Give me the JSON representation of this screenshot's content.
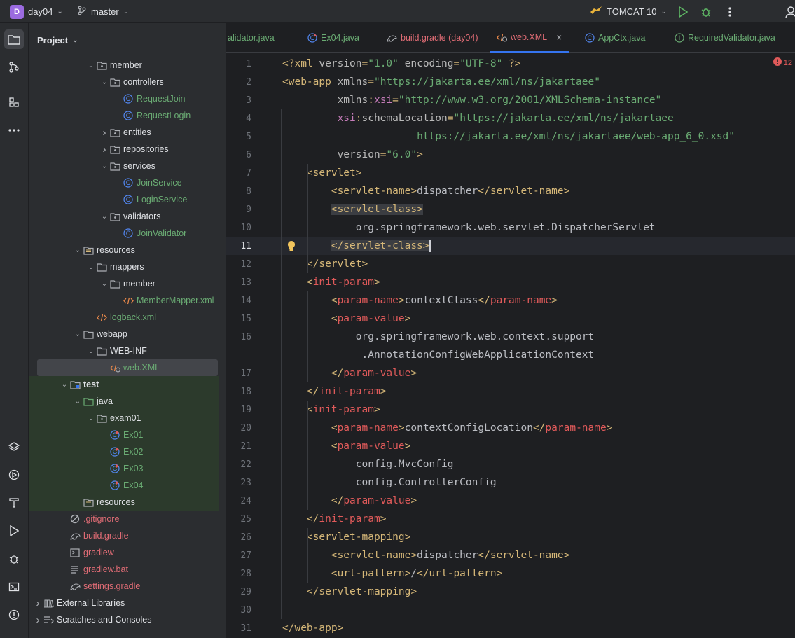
{
  "topbar": {
    "project_badge": "D",
    "project_name": "day04",
    "branch": "master",
    "run_config": "TOMCAT 10"
  },
  "panel": {
    "title": "Project"
  },
  "tree": [
    {
      "label": "member",
      "type": "package",
      "indent": 4,
      "arrow": "v",
      "color": "#dfe1e5"
    },
    {
      "label": "controllers",
      "type": "package",
      "indent": 5,
      "arrow": "v",
      "color": "#dfe1e5"
    },
    {
      "label": "RequestJoin",
      "type": "class",
      "indent": 6,
      "arrow": "",
      "color": "#6aab73"
    },
    {
      "label": "RequestLogin",
      "type": "class",
      "indent": 6,
      "arrow": "",
      "color": "#6aab73"
    },
    {
      "label": "entities",
      "type": "package",
      "indent": 5,
      "arrow": ">",
      "color": "#dfe1e5"
    },
    {
      "label": "repositories",
      "type": "package",
      "indent": 5,
      "arrow": ">",
      "color": "#dfe1e5"
    },
    {
      "label": "services",
      "type": "package",
      "indent": 5,
      "arrow": "v",
      "color": "#dfe1e5"
    },
    {
      "label": "JoinService",
      "type": "class",
      "indent": 6,
      "arrow": "",
      "color": "#6aab73"
    },
    {
      "label": "LoginService",
      "type": "class",
      "indent": 6,
      "arrow": "",
      "color": "#6aab73"
    },
    {
      "label": "validators",
      "type": "package",
      "indent": 5,
      "arrow": "v",
      "color": "#dfe1e5"
    },
    {
      "label": "JoinValidator",
      "type": "class",
      "indent": 6,
      "arrow": "",
      "color": "#6aab73"
    },
    {
      "label": "resources",
      "type": "resfolder",
      "indent": 3,
      "arrow": "v",
      "color": "#dfe1e5"
    },
    {
      "label": "mappers",
      "type": "folder",
      "indent": 4,
      "arrow": "v",
      "color": "#dfe1e5"
    },
    {
      "label": "member",
      "type": "folder",
      "indent": 5,
      "arrow": "v",
      "color": "#dfe1e5"
    },
    {
      "label": "MemberMapper.xml",
      "type": "xml",
      "indent": 6,
      "arrow": "",
      "color": "#6aab73"
    },
    {
      "label": "logback.xml",
      "type": "xml",
      "indent": 4,
      "arrow": "",
      "color": "#6aab73"
    },
    {
      "label": "webapp",
      "type": "folder",
      "indent": 3,
      "arrow": "v",
      "color": "#dfe1e5"
    },
    {
      "label": "WEB-INF",
      "type": "folder",
      "indent": 4,
      "arrow": "v",
      "color": "#dfe1e5"
    },
    {
      "label": "web.XML",
      "type": "webxml",
      "indent": 5,
      "arrow": "",
      "color": "#6aab73",
      "selected": true
    },
    {
      "label": "test",
      "type": "testmodule",
      "indent": 2,
      "arrow": "v",
      "color": "#dfe1e5",
      "test": true,
      "bold": true
    },
    {
      "label": "java",
      "type": "greenfolder",
      "indent": 3,
      "arrow": "v",
      "color": "#dfe1e5",
      "test": true
    },
    {
      "label": "exam01",
      "type": "package",
      "indent": 4,
      "arrow": "v",
      "color": "#dfe1e5",
      "test": true
    },
    {
      "label": "Ex01",
      "type": "testclass",
      "indent": 5,
      "arrow": "",
      "color": "#6aab73",
      "test": true
    },
    {
      "label": "Ex02",
      "type": "testclass",
      "indent": 5,
      "arrow": "",
      "color": "#6aab73",
      "test": true
    },
    {
      "label": "Ex03",
      "type": "testclass",
      "indent": 5,
      "arrow": "",
      "color": "#6aab73",
      "test": true
    },
    {
      "label": "Ex04",
      "type": "testclass",
      "indent": 5,
      "arrow": "",
      "color": "#6aab73",
      "test": true
    },
    {
      "label": "resources",
      "type": "resfolder",
      "indent": 3,
      "arrow": "",
      "color": "#dfe1e5",
      "test": true
    },
    {
      "label": ".gitignore",
      "type": "ignore",
      "indent": 2,
      "arrow": "",
      "color": "#e06c75"
    },
    {
      "label": "build.gradle",
      "type": "gradle",
      "indent": 2,
      "arrow": "",
      "color": "#e06c75"
    },
    {
      "label": "gradlew",
      "type": "terminal",
      "indent": 2,
      "arrow": "",
      "color": "#e06c75"
    },
    {
      "label": "gradlew.bat",
      "type": "text",
      "indent": 2,
      "arrow": "",
      "color": "#e06c75"
    },
    {
      "label": "settings.gradle",
      "type": "gradle",
      "indent": 2,
      "arrow": "",
      "color": "#e06c75"
    },
    {
      "label": "External Libraries",
      "type": "libs",
      "indent": 0,
      "arrow": ">",
      "color": "#dfe1e5"
    },
    {
      "label": "Scratches and Consoles",
      "type": "scratch",
      "indent": 0,
      "arrow": ">",
      "color": "#dfe1e5"
    }
  ],
  "tabs": [
    {
      "label": "alidator.java",
      "icon": "none",
      "color": "#6aab73"
    },
    {
      "label": "Ex04.java",
      "icon": "testclass",
      "color": "#6aab73"
    },
    {
      "label": "build.gradle (day04)",
      "icon": "gradle",
      "color": "#e06c75"
    },
    {
      "label": "web.XML",
      "icon": "webxml",
      "color": "#e06c75",
      "active": true,
      "close": "×"
    },
    {
      "label": "AppCtx.java",
      "icon": "class",
      "color": "#6aab73"
    },
    {
      "label": "RequiredValidator.java",
      "icon": "iface",
      "color": "#6aab73"
    }
  ],
  "editor": {
    "error_count": "12",
    "current_line": 11,
    "lines": [
      {
        "n": "1",
        "parts": [
          [
            "t",
            "<?xml "
          ],
          [
            "a",
            "version"
          ],
          [
            "t",
            "="
          ],
          [
            "s",
            "\"1.0\""
          ],
          [
            "t",
            " "
          ],
          [
            "a",
            "encoding"
          ],
          [
            "t",
            "="
          ],
          [
            "s",
            "\"UTF-8\""
          ],
          [
            "t",
            " ?>"
          ]
        ]
      },
      {
        "n": "2",
        "parts": [
          [
            "t",
            "<web-app "
          ],
          [
            "a",
            "xmlns"
          ],
          [
            "t",
            "="
          ],
          [
            "s",
            "\"https://jakarta.ee/xml/ns/jakartaee\""
          ]
        ]
      },
      {
        "n": "3",
        "parts": [
          [
            "p",
            "         "
          ],
          [
            "a",
            "xmlns"
          ],
          [
            "t",
            ":"
          ],
          [
            "n",
            "xsi"
          ],
          [
            "t",
            "="
          ],
          [
            "s",
            "\"http://www.w3.org/2001/XMLSchema-instance\""
          ]
        ]
      },
      {
        "n": "4",
        "parts": [
          [
            "p",
            "         "
          ],
          [
            "n",
            "xsi"
          ],
          [
            "t",
            ":"
          ],
          [
            "a",
            "schemaLocation"
          ],
          [
            "t",
            "="
          ],
          [
            "s",
            "\"https://jakarta.ee/xml/ns/jakartaee"
          ]
        ]
      },
      {
        "n": "5",
        "parts": [
          [
            "p",
            "                      "
          ],
          [
            "s",
            "https://jakarta.ee/xml/ns/jakartaee/web-app_6_0.xsd\""
          ]
        ]
      },
      {
        "n": "6",
        "parts": [
          [
            "p",
            "         "
          ],
          [
            "a",
            "version"
          ],
          [
            "t",
            "="
          ],
          [
            "s",
            "\"6.0\""
          ],
          [
            "t",
            ">"
          ]
        ]
      },
      {
        "n": "7",
        "parts": [
          [
            "p",
            "    "
          ],
          [
            "t",
            "<servlet>"
          ]
        ]
      },
      {
        "n": "8",
        "parts": [
          [
            "p",
            "        "
          ],
          [
            "t",
            "<servlet-name>"
          ],
          [
            "x",
            "dispatcher"
          ],
          [
            "t",
            "</servlet-name>"
          ]
        ]
      },
      {
        "n": "9",
        "parts": [
          [
            "p",
            "        "
          ],
          [
            "t",
            "<servlet-class>"
          ]
        ]
      },
      {
        "n": "10",
        "parts": [
          [
            "p",
            "            "
          ],
          [
            "x",
            "org.springframework.web.servlet.DispatcherServlet"
          ]
        ]
      },
      {
        "n": "11",
        "parts": [
          [
            "p",
            "        "
          ],
          [
            "t",
            "</servlet-class>"
          ]
        ]
      },
      {
        "n": "12",
        "parts": [
          [
            "p",
            "    "
          ],
          [
            "t",
            "</servlet>"
          ]
        ]
      },
      {
        "n": "13",
        "parts": [
          [
            "p",
            "    "
          ],
          [
            "t",
            "<"
          ],
          [
            "r",
            "init-param"
          ],
          [
            "t",
            ">"
          ]
        ]
      },
      {
        "n": "14",
        "parts": [
          [
            "p",
            "        "
          ],
          [
            "t",
            "<"
          ],
          [
            "r",
            "param-name"
          ],
          [
            "t",
            ">"
          ],
          [
            "x",
            "contextClass"
          ],
          [
            "t",
            "</"
          ],
          [
            "r",
            "param-name"
          ],
          [
            "t",
            ">"
          ]
        ]
      },
      {
        "n": "15",
        "parts": [
          [
            "p",
            "        "
          ],
          [
            "t",
            "<"
          ],
          [
            "r",
            "param-value"
          ],
          [
            "t",
            ">"
          ]
        ]
      },
      {
        "n": "16",
        "parts": [
          [
            "p",
            "            "
          ],
          [
            "x",
            "org.springframework.web.context.support"
          ]
        ]
      },
      {
        "n": "",
        "parts": [
          [
            "p",
            "             "
          ],
          [
            "x",
            ".AnnotationConfigWebApplicationContext"
          ]
        ]
      },
      {
        "n": "17",
        "parts": [
          [
            "p",
            "        "
          ],
          [
            "t",
            "</"
          ],
          [
            "r",
            "param-value"
          ],
          [
            "t",
            ">"
          ]
        ]
      },
      {
        "n": "18",
        "parts": [
          [
            "p",
            "    "
          ],
          [
            "t",
            "</"
          ],
          [
            "r",
            "init-param"
          ],
          [
            "t",
            ">"
          ]
        ]
      },
      {
        "n": "19",
        "parts": [
          [
            "p",
            "    "
          ],
          [
            "t",
            "<"
          ],
          [
            "r",
            "init-param"
          ],
          [
            "t",
            ">"
          ]
        ]
      },
      {
        "n": "20",
        "parts": [
          [
            "p",
            "        "
          ],
          [
            "t",
            "<"
          ],
          [
            "r",
            "param-name"
          ],
          [
            "t",
            ">"
          ],
          [
            "x",
            "contextConfigLocation"
          ],
          [
            "t",
            "</"
          ],
          [
            "r",
            "param-name"
          ],
          [
            "t",
            ">"
          ]
        ]
      },
      {
        "n": "21",
        "parts": [
          [
            "p",
            "        "
          ],
          [
            "t",
            "<"
          ],
          [
            "r",
            "param-value"
          ],
          [
            "t",
            ">"
          ]
        ]
      },
      {
        "n": "22",
        "parts": [
          [
            "p",
            "            "
          ],
          [
            "x",
            "config.MvcConfig"
          ]
        ]
      },
      {
        "n": "23",
        "parts": [
          [
            "p",
            "            "
          ],
          [
            "x",
            "config.ControllerConfig"
          ]
        ]
      },
      {
        "n": "24",
        "parts": [
          [
            "p",
            "        "
          ],
          [
            "t",
            "</"
          ],
          [
            "r",
            "param-value"
          ],
          [
            "t",
            ">"
          ]
        ]
      },
      {
        "n": "25",
        "parts": [
          [
            "p",
            "    "
          ],
          [
            "t",
            "</"
          ],
          [
            "r",
            "init-param"
          ],
          [
            "t",
            ">"
          ]
        ]
      },
      {
        "n": "26",
        "parts": [
          [
            "p",
            "    "
          ],
          [
            "t",
            "<servlet-mapping>"
          ]
        ]
      },
      {
        "n": "27",
        "parts": [
          [
            "p",
            "        "
          ],
          [
            "t",
            "<servlet-name>"
          ],
          [
            "x",
            "dispatcher"
          ],
          [
            "t",
            "</servlet-name>"
          ]
        ]
      },
      {
        "n": "28",
        "parts": [
          [
            "p",
            "        "
          ],
          [
            "t",
            "<url-pattern>"
          ],
          [
            "x",
            "/"
          ],
          [
            "t",
            "</url-pattern>"
          ]
        ]
      },
      {
        "n": "29",
        "parts": [
          [
            "p",
            "    "
          ],
          [
            "t",
            "</servlet-mapping>"
          ]
        ]
      },
      {
        "n": "30",
        "parts": []
      },
      {
        "n": "31",
        "parts": [
          [
            "t",
            "</web-app>"
          ]
        ]
      }
    ]
  },
  "colors": {
    "accent": "#3574f0",
    "tag": "#d5b778",
    "string": "#6aab73",
    "namespace": "#c77dbb",
    "error": "#e05a5a"
  }
}
